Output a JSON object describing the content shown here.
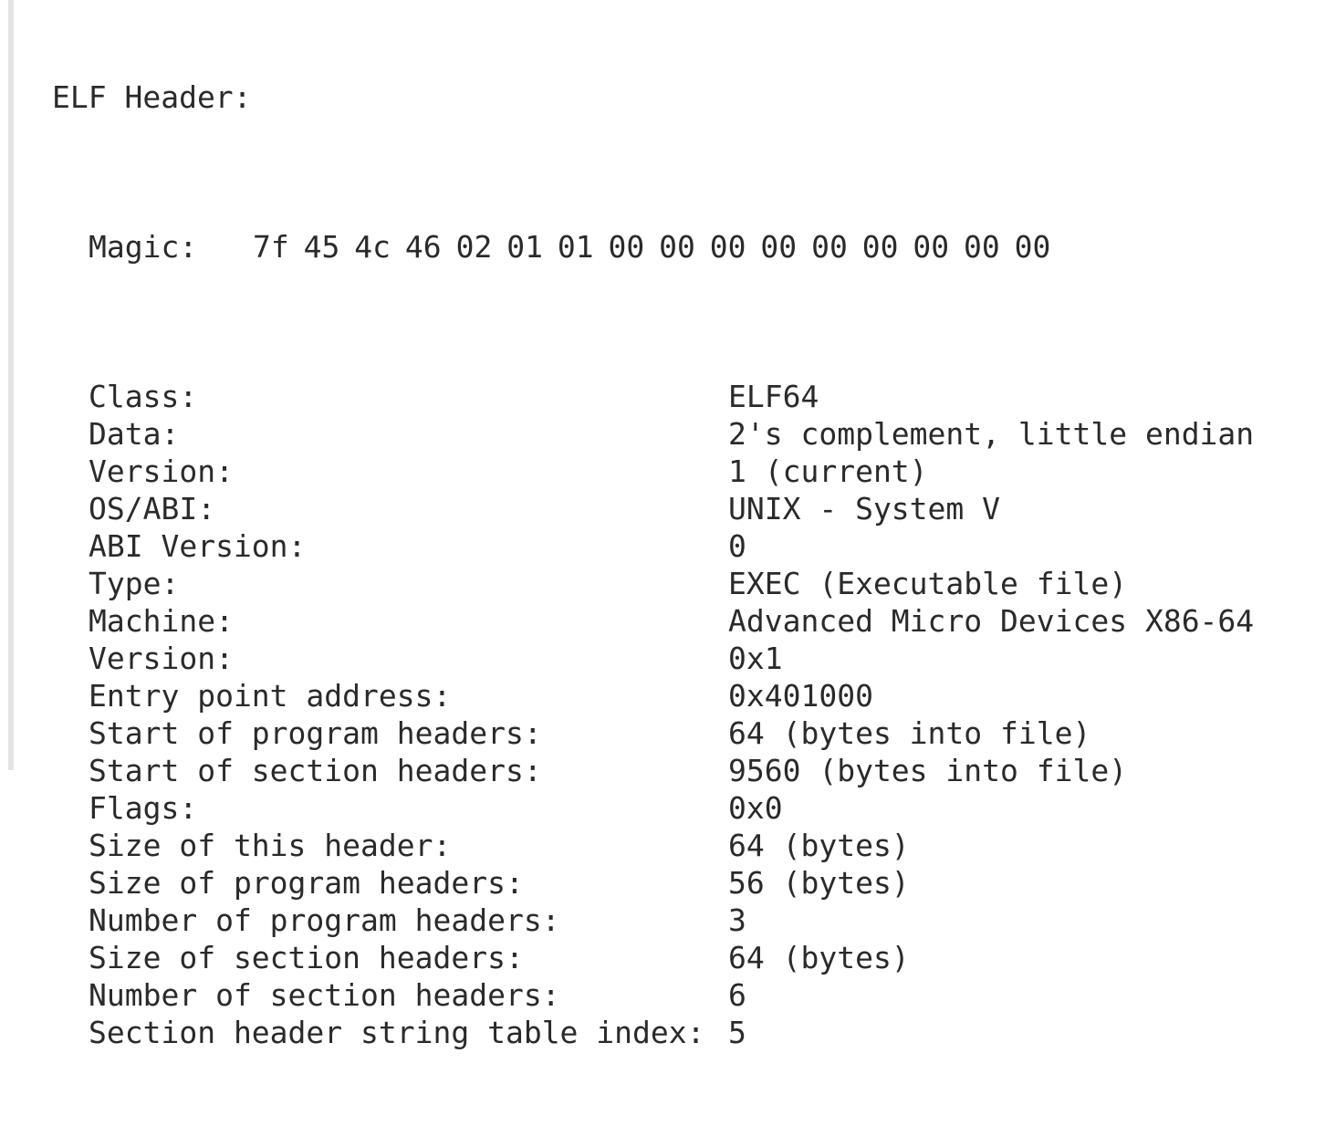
{
  "header_title": "ELF Header:",
  "magic": {
    "label": "Magic:",
    "bytes": "7f 45 4c 46 02 01 01 00 00 00 00 00 00 00 00 00"
  },
  "fields": [
    {
      "label": "Class:",
      "value": "ELF64"
    },
    {
      "label": "Data:",
      "value": "2's complement, little endian"
    },
    {
      "label": "Version:",
      "value": "1 (current)"
    },
    {
      "label": "OS/ABI:",
      "value": "UNIX - System V"
    },
    {
      "label": "ABI Version:",
      "value": "0"
    },
    {
      "label": "Type:",
      "value": "EXEC (Executable file)"
    },
    {
      "label": "Machine:",
      "value": "Advanced Micro Devices X86-64"
    },
    {
      "label": "Version:",
      "value": "0x1"
    },
    {
      "label": "Entry point address:",
      "value": "0x401000"
    },
    {
      "label": "Start of program headers:",
      "value": "64 (bytes into file)"
    },
    {
      "label": "Start of section headers:",
      "value": "9560 (bytes into file)"
    },
    {
      "label": "Flags:",
      "value": "0x0"
    },
    {
      "label": "Size of this header:",
      "value": "64 (bytes)"
    },
    {
      "label": "Size of program headers:",
      "value": "56 (bytes)"
    },
    {
      "label": "Number of program headers:",
      "value": "3"
    },
    {
      "label": "Size of section headers:",
      "value": "64 (bytes)"
    },
    {
      "label": "Number of section headers:",
      "value": "6"
    },
    {
      "label": "Section header string table index:",
      "value": "5"
    }
  ]
}
